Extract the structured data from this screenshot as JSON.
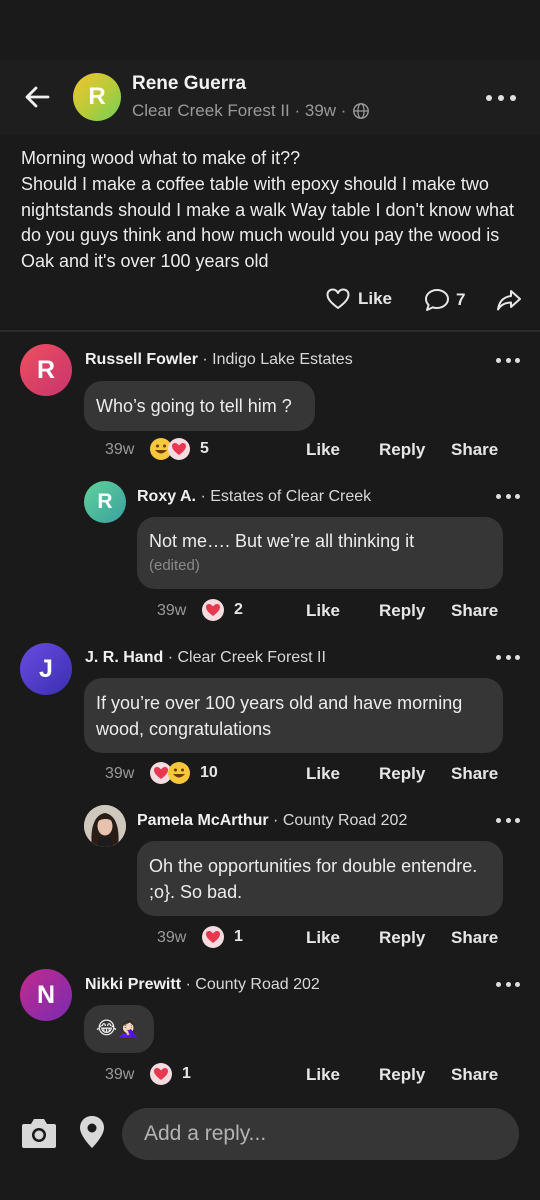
{
  "post": {
    "author": "Rene Guerra",
    "avatar_initial": "R",
    "meta": "Clear Creek Forest II · 39w ·",
    "text_line1": "Morning wood what to make of it??",
    "text_line2": "Should I make a coffee table with epoxy should I make two nightstands should I make a walk Way table I don't know what do you guys think and how much would you pay the wood is Oak and it's over 100 years old",
    "like_label": "Like",
    "comment_count": "7"
  },
  "comments": [
    {
      "name": "Russell Fowler",
      "location": "· Indigo Lake Estates",
      "initial": "R",
      "text": "Who’s going to tell him ?",
      "time": "39w",
      "reaction_count": "5",
      "like": "Like",
      "reply": "Reply",
      "share": "Share"
    },
    {
      "name": "Roxy A.",
      "location": "· Estates of Clear Creek",
      "initial": "R",
      "text": "Not me…. But we’re all thinking it",
      "edited": "(edited)",
      "time": "39w",
      "reaction_count": "2",
      "like": "Like",
      "reply": "Reply",
      "share": "Share"
    },
    {
      "name": "J. R. Hand",
      "location": "· Clear Creek Forest II",
      "initial": "J",
      "text": "If you’re over 100 years old  and have morning wood, congratulations",
      "time": "39w",
      "reaction_count": "10",
      "like": "Like",
      "reply": "Reply",
      "share": "Share"
    },
    {
      "name": "Pamela McArthur",
      "location": "· County Road 202",
      "text": "Oh the opportunities for double entendre. ;o}. So bad.",
      "time": "39w",
      "reaction_count": "1",
      "like": "Like",
      "reply": "Reply",
      "share": "Share"
    },
    {
      "name": "Nikki Prewitt",
      "location": "· County Road 202",
      "initial": "N",
      "text": "😂🤦🏻‍♀️",
      "time": "39w",
      "reaction_count": "1",
      "like": "Like",
      "reply": "Reply",
      "share": "Share"
    }
  ],
  "reply_box": {
    "placeholder": "Add a reply..."
  },
  "colors": {
    "background": "#1a1a1a",
    "bubble": "#363636",
    "avatar_russell": "#e0445a",
    "avatar_roxy": "#4fbf8f",
    "avatar_jr": "#5b3fd1",
    "avatar_nikki": "#a8248a"
  }
}
